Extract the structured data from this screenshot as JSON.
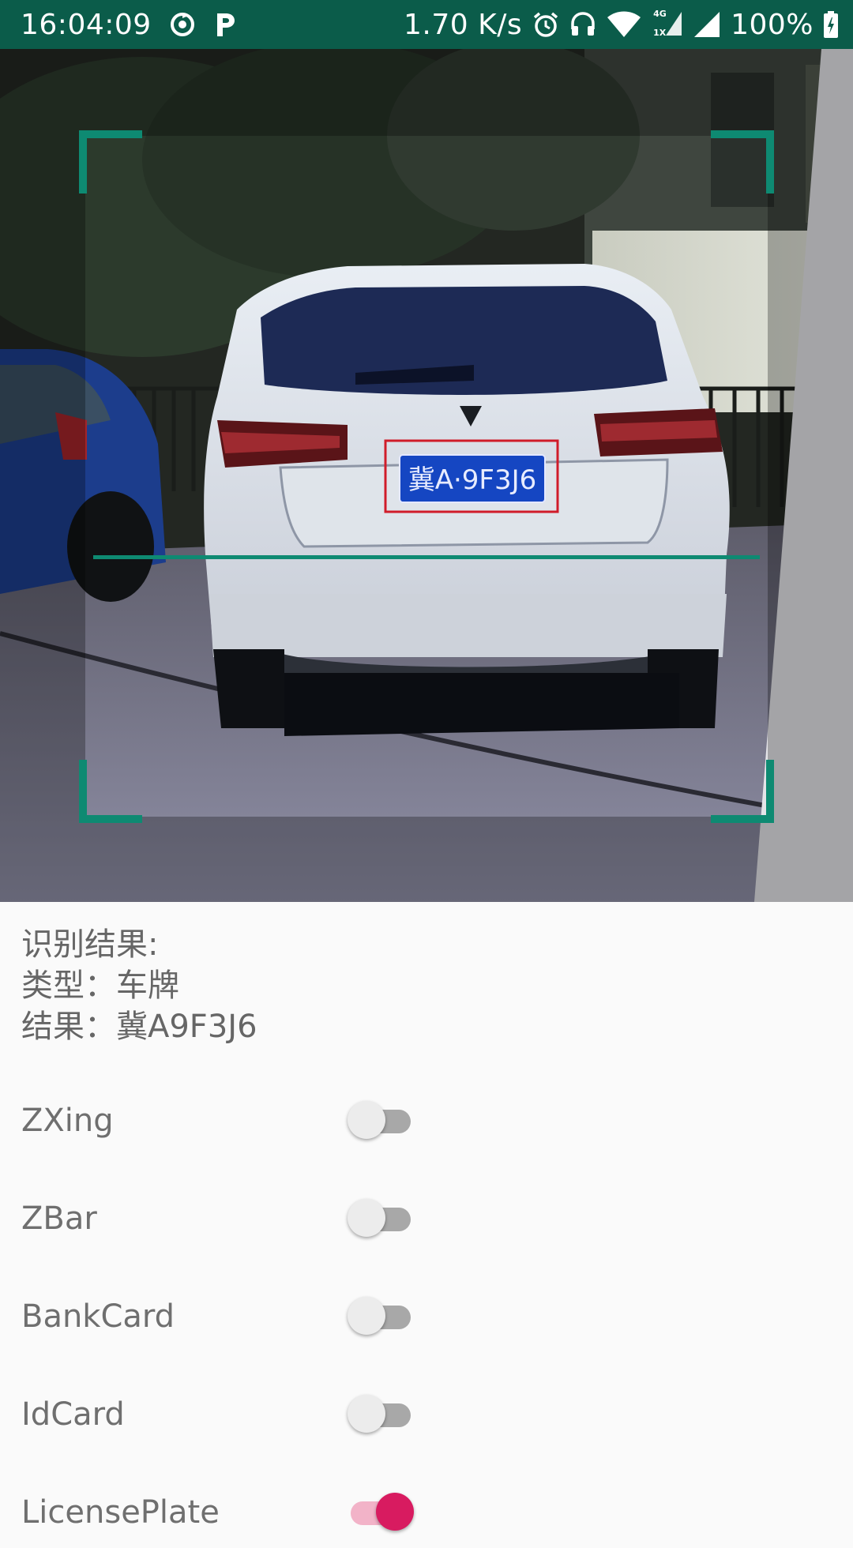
{
  "status_bar": {
    "time": "16:04:09",
    "net_speed": "1.70 K/s",
    "network_type": "4G",
    "signal_sub": "1X",
    "battery": "100%",
    "icons": [
      "sync-icon",
      "parking-app-icon",
      "alarm-icon",
      "headphones-icon",
      "wifi-icon",
      "cell-signal-icon",
      "battery-icon"
    ]
  },
  "camera": {
    "scanner_color": "#0e8a72",
    "plate_text": "冀A·9F3J6"
  },
  "result": {
    "heading": "识别结果:",
    "type_line": "类型：车牌",
    "value_line": "结果：冀A9F3J6"
  },
  "options": [
    {
      "label": "ZXing",
      "on": false
    },
    {
      "label": "ZBar",
      "on": false
    },
    {
      "label": "BankCard",
      "on": false
    },
    {
      "label": "IdCard",
      "on": false
    },
    {
      "label": "LicensePlate",
      "on": true
    }
  ],
  "colors": {
    "status_bar": "#0b5c4a",
    "accent_on": "#d81b60",
    "track_on": "#f2b3c8",
    "track_off": "#a8a8a8"
  }
}
